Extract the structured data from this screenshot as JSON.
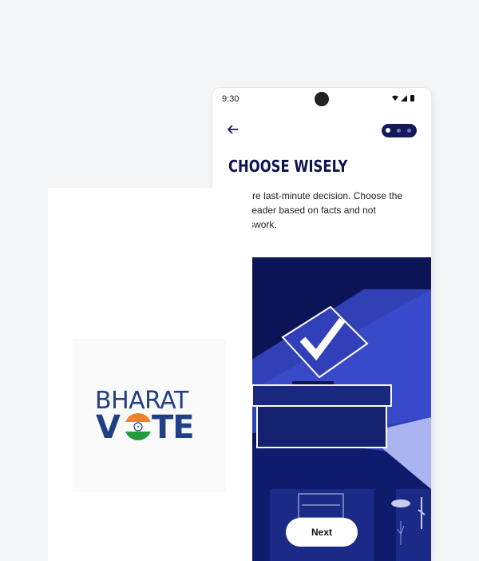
{
  "status_bar": {
    "time": "9:30",
    "icons": [
      "wifi-icon",
      "signal-icon",
      "battery-icon"
    ]
  },
  "onboarding": {
    "title": "CHOOSE WISELY",
    "description": "Explore last-minute decision. Choose the right leader based on facts and not guesswork.",
    "next_label": "Next",
    "pager": {
      "total": 3,
      "active_index": 0
    }
  },
  "splash": {
    "logo_line1": "BHARAT",
    "logo_line2_left": "V",
    "logo_line2_right": "TE"
  },
  "colors": {
    "navy": "#0e1450",
    "royal_blue": "#3344cc",
    "accent_blue": "#4050e0",
    "brand": "#1f3f86"
  }
}
